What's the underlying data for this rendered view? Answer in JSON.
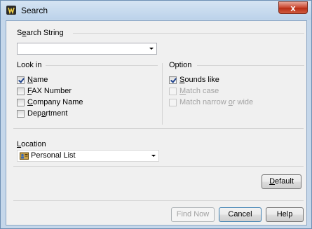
{
  "window": {
    "title": "Search",
    "close_label": "x"
  },
  "search_string": {
    "label_pre": "S",
    "label_ul": "e",
    "label_post": "arch String",
    "value": ""
  },
  "look_in": {
    "label": "Look in",
    "items": [
      {
        "pre": "",
        "ul": "N",
        "post": "ame",
        "checked": true
      },
      {
        "pre": "",
        "ul": "F",
        "post": "AX Number",
        "checked": false
      },
      {
        "pre": "",
        "ul": "C",
        "post": "ompany Name",
        "checked": false
      },
      {
        "pre": "Dep",
        "ul": "a",
        "post": "rtment",
        "checked": false
      }
    ]
  },
  "option": {
    "label": "Option",
    "items": [
      {
        "pre": "",
        "ul": "S",
        "post": "ounds like",
        "checked": true,
        "enabled": true
      },
      {
        "pre": "",
        "ul": "M",
        "post": "atch case",
        "checked": false,
        "enabled": false
      },
      {
        "pre": "Match narrow ",
        "ul": "o",
        "post": "r wide",
        "checked": false,
        "enabled": false
      }
    ]
  },
  "location": {
    "label_pre": "",
    "label_ul": "L",
    "label_post": "ocation",
    "value": "Personal List",
    "icon": "address-book-icon"
  },
  "buttons": {
    "default_pre": "",
    "default_ul": "D",
    "default_post": "efault",
    "find_now": "Find Now",
    "cancel": "Cancel",
    "help": "Help"
  }
}
